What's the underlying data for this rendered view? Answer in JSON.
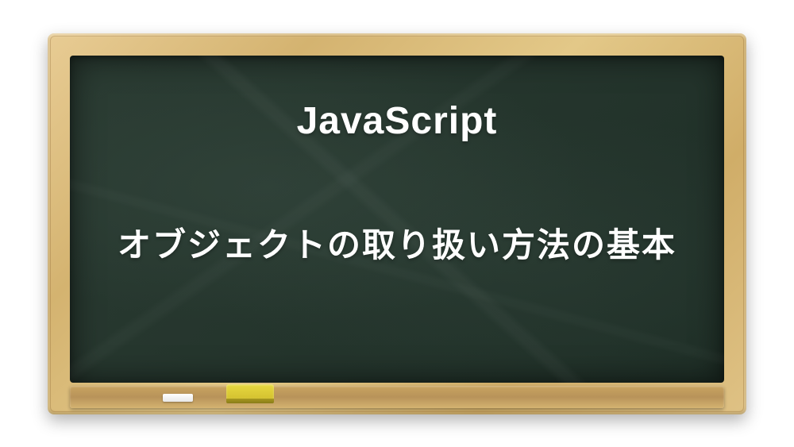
{
  "board": {
    "title": "JavaScript",
    "subtitle": "オブジェクトの取り扱い方法の基本"
  }
}
